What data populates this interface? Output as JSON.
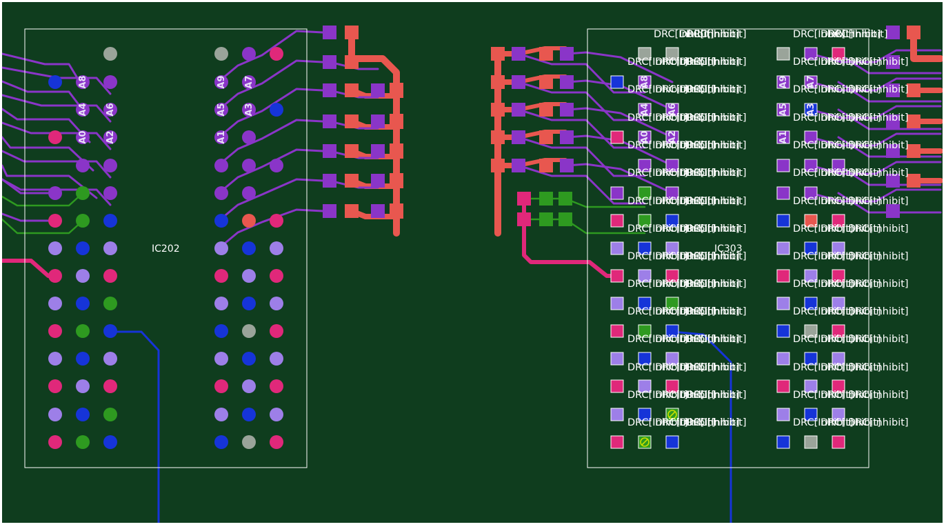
{
  "board": {
    "background": "#0f3d1e",
    "outline_color": "#ffffff"
  },
  "components": {
    "ic202": {
      "refdes": "IC202"
    },
    "ic303": {
      "refdes": "IC303"
    }
  },
  "pin_labels_left": [
    "A8",
    "A9",
    "A7",
    "A4",
    "A6",
    "A5",
    "A3",
    "A0",
    "A2",
    "A1"
  ],
  "pin_labels_right": [
    "A8",
    "A6",
    "A9",
    "A7",
    "A4",
    "A5",
    "A3",
    "A0",
    "A2",
    "A1"
  ],
  "drc_marker_text": "DRC[Inhibit]",
  "layer_colors": {
    "signal_purple": "#8a35c8",
    "signal_green": "#2e9a20",
    "copper_red": "#e8574f",
    "power_pink": "#e0287a",
    "ground_blue": "#1634d8",
    "lavender": "#9d7fe8",
    "gray": "#9aa49a",
    "drc_marker": "#c8e000"
  },
  "icons": {
    "drc_violation": "circle-slash-icon"
  }
}
